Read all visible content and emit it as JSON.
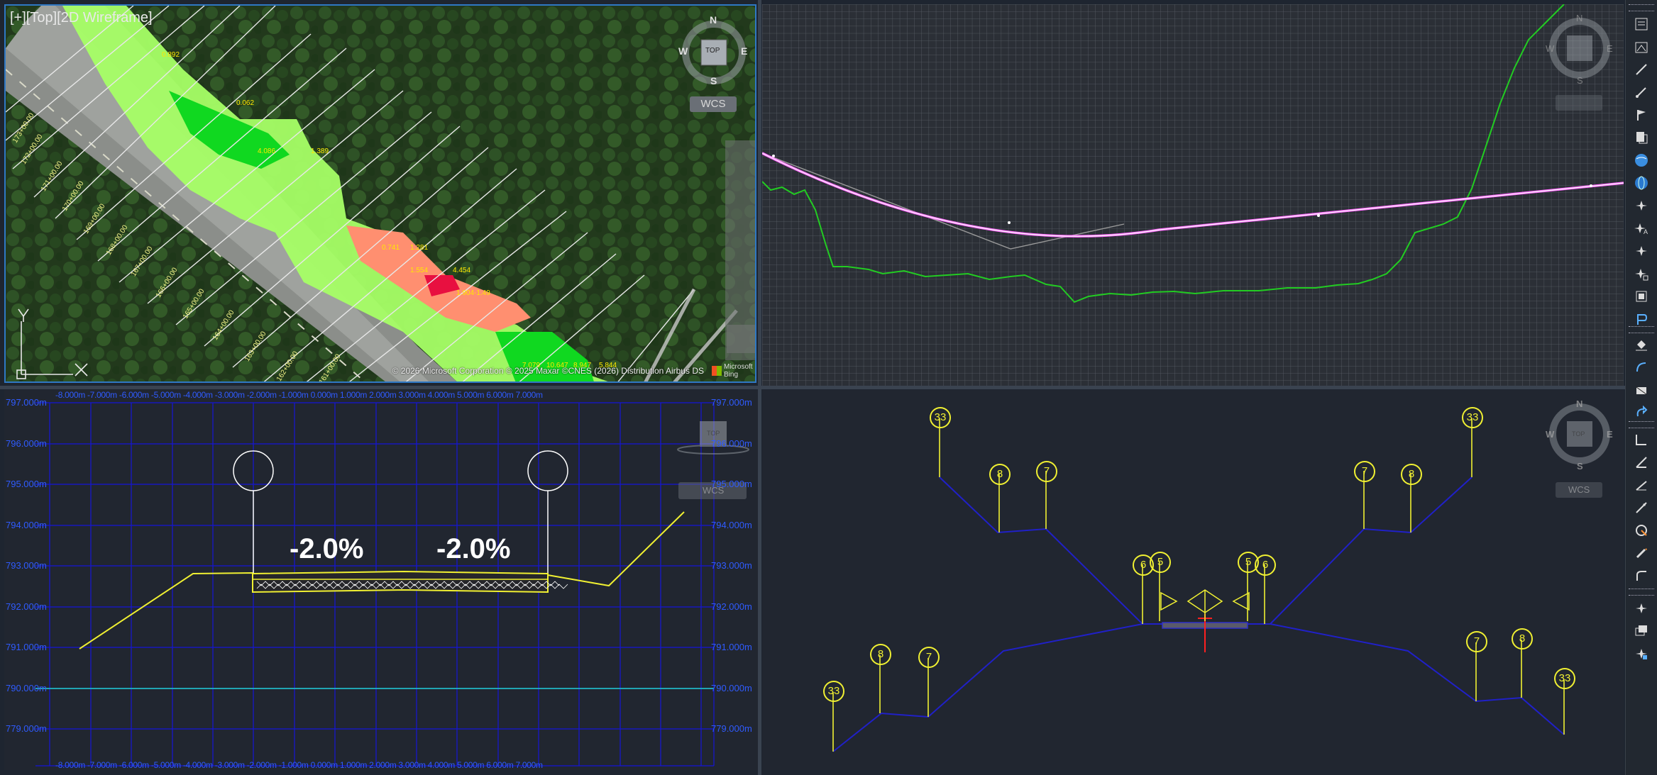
{
  "viewports": {
    "plan": {
      "label": "[+][Top][2D Wireframe]",
      "copyright": "© 2026 Microsoft Corporation © 2025 Maxar ©CNES (2026) Distribution Airbus DS",
      "bing_text": "Microsoft Bing",
      "viewcube": {
        "top": "TOP",
        "n": "N",
        "s": "S",
        "e": "E",
        "w": "W"
      },
      "wcs": "WCS",
      "ucs_x": "X",
      "ucs_y": "Y",
      "station_labels": [
        "173+00.00",
        "172+00.00",
        "171+00.00",
        "170+00.00",
        "169+00.00",
        "168+00.00",
        "167+00.00",
        "166+00.00",
        "165+00.00",
        "164+00.00",
        "163+00.00",
        "162+00.00",
        "161+00.00"
      ],
      "cutfill_labels": [
        "0.892",
        "0.062",
        "4.086",
        "1.389",
        "0.741",
        "1.281",
        "4.454",
        "1.554",
        "1.904",
        "-1.49",
        "7.079",
        "10.647",
        "8.947",
        "5.844"
      ]
    },
    "profile": {
      "viewcube": {
        "n": "N",
        "s": "S",
        "e": "E",
        "w": "W"
      }
    },
    "section": {
      "slopes": [
        "-2.0%",
        "-2.0%"
      ],
      "elevations": [
        "797.000m",
        "796.000m",
        "795.000m",
        "794.000m",
        "793.000m",
        "792.000m",
        "791.000m",
        "790.000m",
        "779.000m"
      ],
      "offsets": "-8.000m -7.000m -6.000m -5.000m -4.000m -3.000m -2.000m -1.000m 0.000m 1.000m 2.000m 3.000m 4.000m 5.000m 6.000m 7.000m",
      "viewcube": {
        "top": "TOP",
        "wcs": "WCS"
      }
    },
    "assembly": {
      "viewcube": {
        "top": "TOP",
        "n": "N",
        "s": "S",
        "e": "E",
        "w": "W"
      },
      "wcs": "WCS",
      "markers": [
        "33",
        "8",
        "7",
        "6",
        "5",
        "5",
        "6",
        "7",
        "8",
        "33",
        "33",
        "8",
        "7",
        "7",
        "8",
        "33"
      ]
    }
  },
  "toolbar": {
    "icons": [
      "properties-icon",
      "panel-icon",
      "draw-icon",
      "line-icon",
      "flag-icon",
      "copy-sheet-icon",
      "globe-icon",
      "globe-blue-icon",
      "point-icon",
      "text-point-icon",
      "star-point-icon",
      "snap-point-icon",
      "box-icon",
      "label-icon",
      "paint-bucket-icon",
      "curve-icon",
      "hatch-icon",
      "rotate-icon",
      "dimension-icon",
      "angle-icon",
      "slope-icon",
      "arrow-line-icon",
      "circle-edit-icon",
      "pencil-icon",
      "bend-icon",
      "magic-icon",
      "layers-icon",
      "settings-icon"
    ]
  },
  "colors": {
    "bg": "#212630",
    "grid_blue": "#1515d8",
    "yellow": "#f0f032",
    "magenta": "#ff66ff",
    "green_line": "#22cc22",
    "cyan": "#22d0d0",
    "fill_green": "#9cff55",
    "cut_salmon": "#ff8f70"
  }
}
